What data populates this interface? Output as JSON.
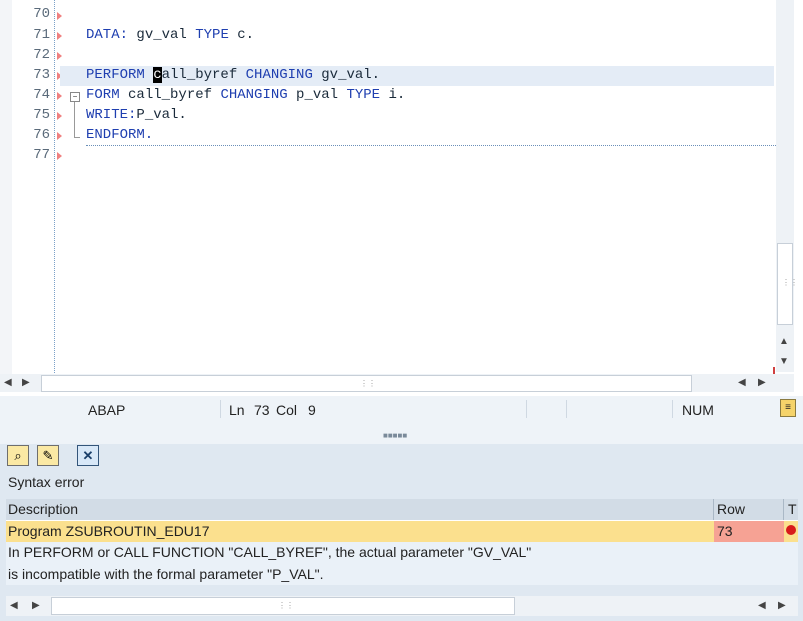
{
  "editor": {
    "line_numbers": [
      "70",
      "71",
      "72",
      "73",
      "74",
      "75",
      "76",
      "77"
    ],
    "lines": {
      "l71_kw1": "DATA:",
      "l71_t1": " gv_val ",
      "l71_kw2": "TYPE",
      "l71_t2": " c.",
      "l73_kw1": "PERFORM",
      "l73_sp": " ",
      "l73_cursor": "c",
      "l73_t1": "all_byref ",
      "l73_kw2": "CHANGING",
      "l73_t2": " gv_val.",
      "l74_kw1": "FORM",
      "l74_t1": " call_byref ",
      "l74_kw2": "CHANGING",
      "l74_t2": " p_val ",
      "l74_kw3": "TYPE",
      "l74_t3": " i.",
      "l75_kw1": "WRITE:",
      "l75_t1": "P_val.",
      "l76_kw1": "ENDFORM."
    }
  },
  "statusbar": {
    "language": "ABAP",
    "ln_label": "Ln",
    "ln_value": "73",
    "col_label": "Col",
    "col_value": "9",
    "num": "NUM"
  },
  "panel": {
    "title": "Syntax error",
    "columns": {
      "description": "Description",
      "row": "Row",
      "type": "T"
    },
    "error_row": {
      "description": "Program ZSUBROUTIN_EDU17",
      "row": "73"
    },
    "message_line1": "In PERFORM or CALL FUNCTION \"CALL_BYREF\", the actual parameter \"GV_VAL\"",
    "message_line2": "is incompatible with the formal parameter \"P_VAL\"."
  },
  "colors": {
    "keyword": "#1f3fb0",
    "error_row_bg": "#fbe08e",
    "row_cell_bg": "#f6a294",
    "error_dot": "#d81b1b"
  }
}
